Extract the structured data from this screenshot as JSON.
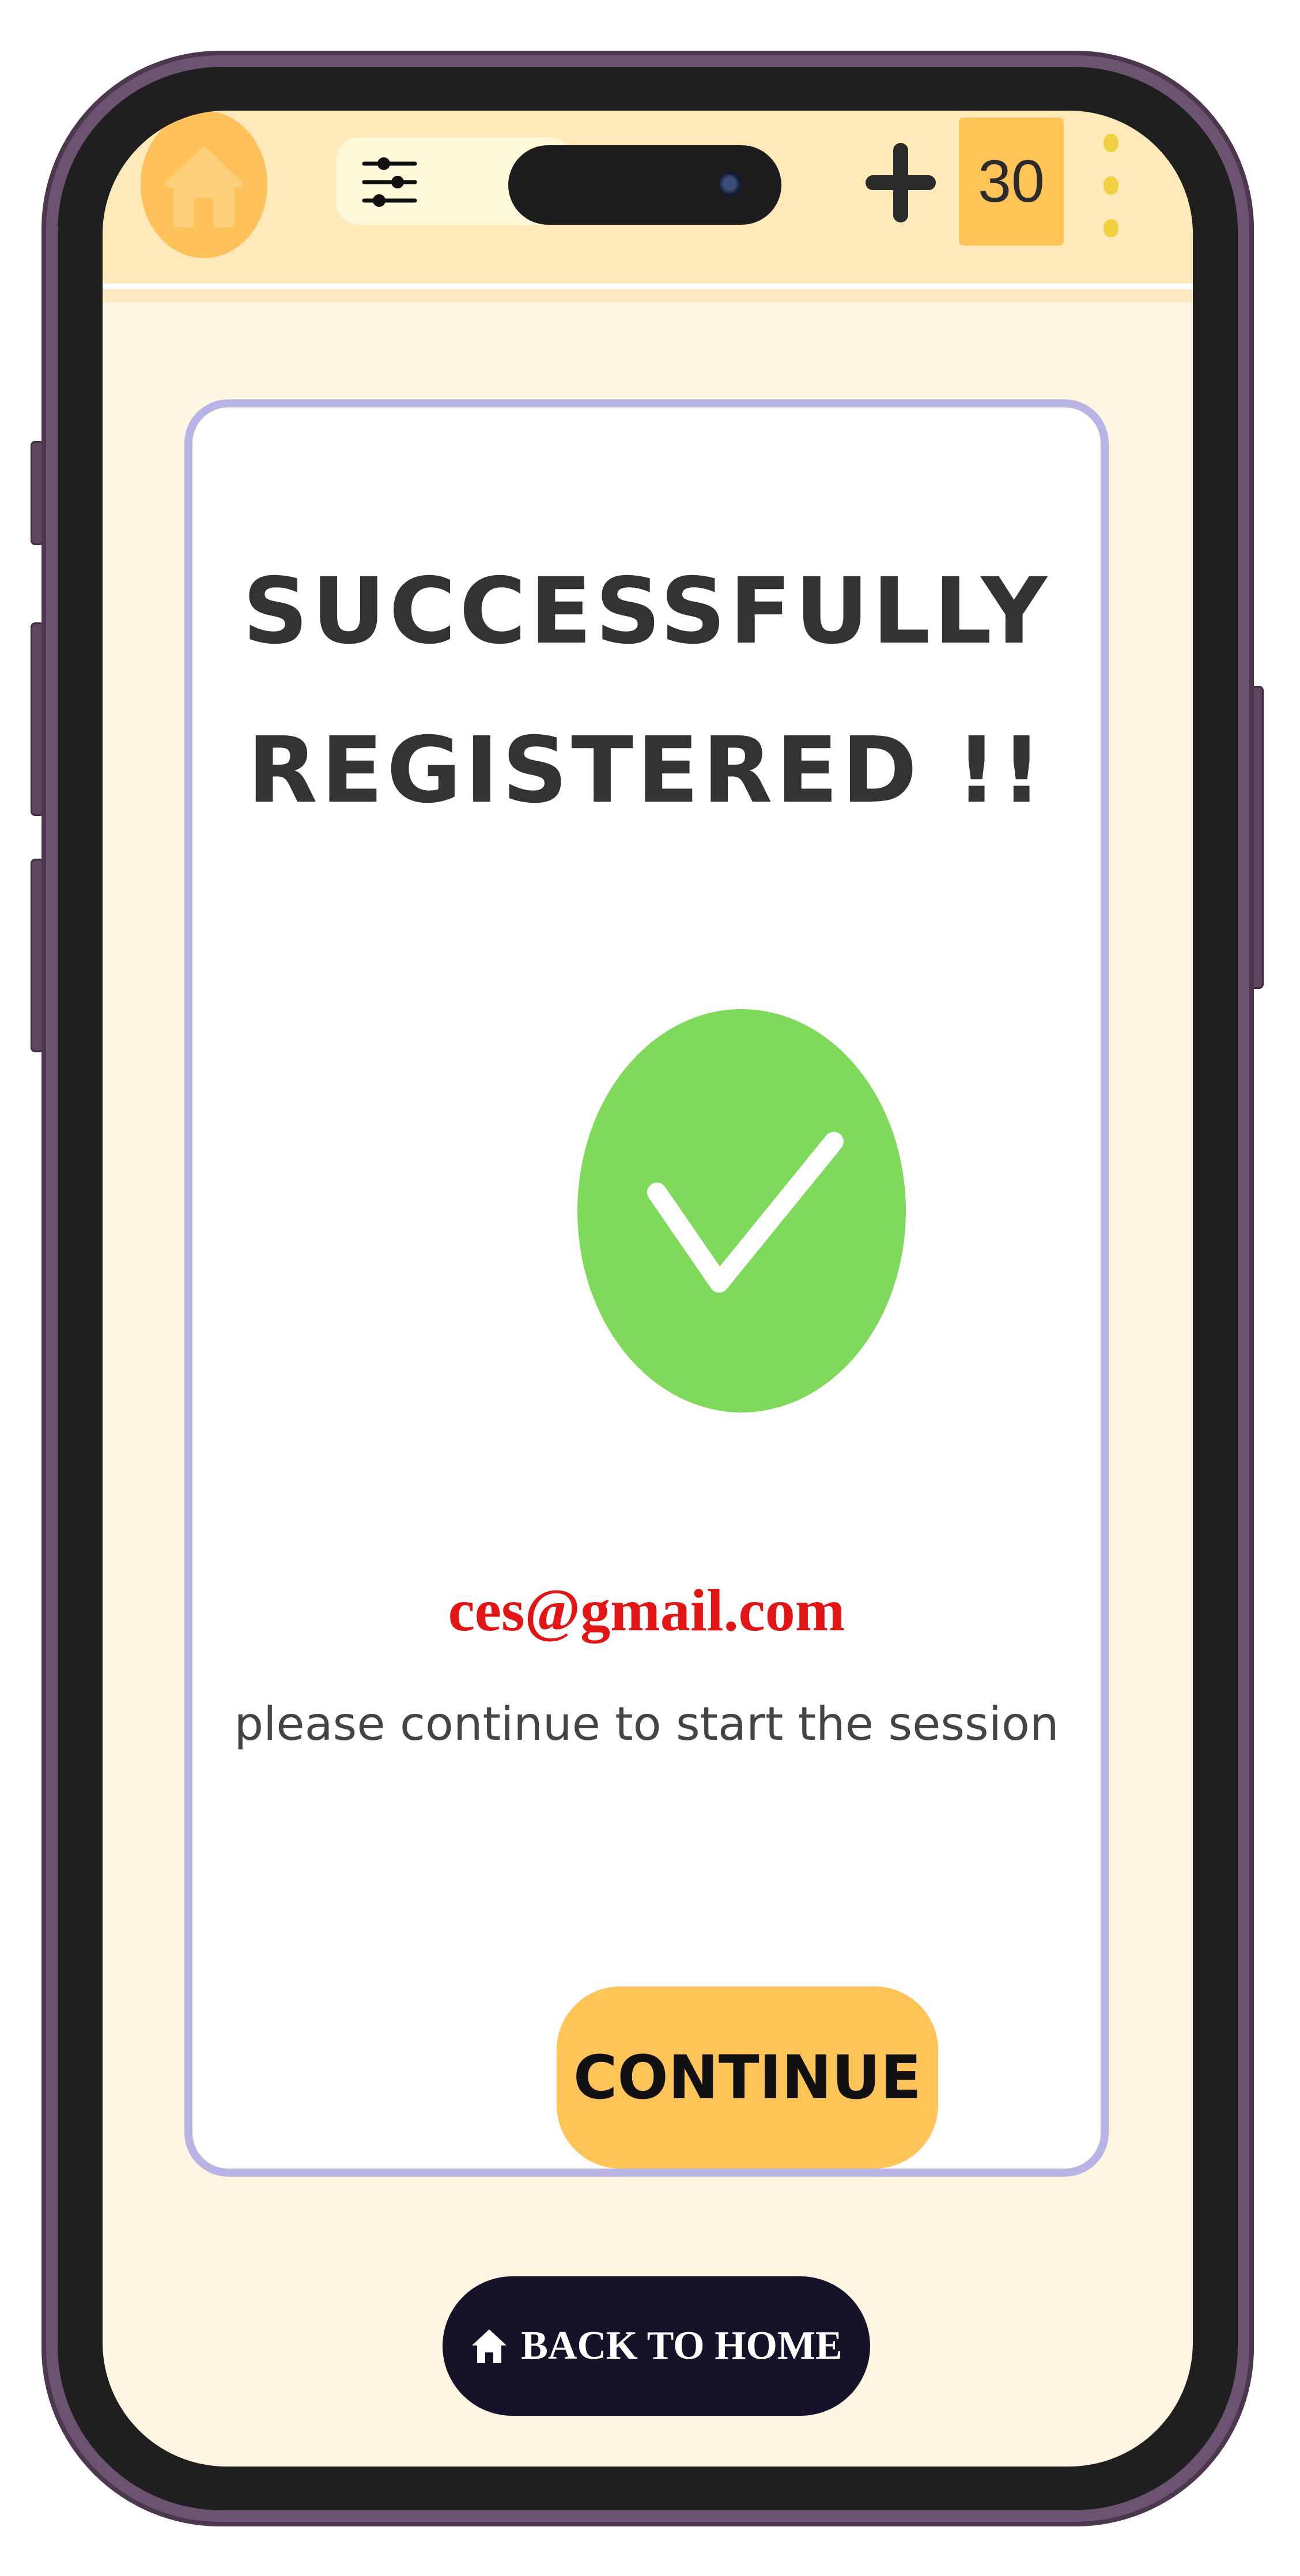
{
  "top_bar": {
    "home_icon": "home-icon",
    "filter_icon": "sliders-icon",
    "add_icon": "plus-icon",
    "counter": "30",
    "menu_icon": "more-vertical-icon"
  },
  "card": {
    "title_line_1": "SUCCESSFULLY",
    "title_line_2": "REGISTERED !!",
    "status_icon": "check-circle-icon",
    "email": "ces@gmail.com",
    "message": "please continue to start the session",
    "continue_label": "CONTINUE"
  },
  "footer": {
    "back_home_icon": "home-icon",
    "back_home_label": "BACK TO HOME"
  },
  "colors": {
    "screen_background": "#fff5e1",
    "top_bar": "#ffe9b8",
    "accent_orange": "#ffc458",
    "card_border": "#b8b4e6",
    "success_green": "#7fd95a",
    "email_red": "#e31414",
    "dark_button": "#15122a",
    "phone_frame": "#6c5372"
  }
}
